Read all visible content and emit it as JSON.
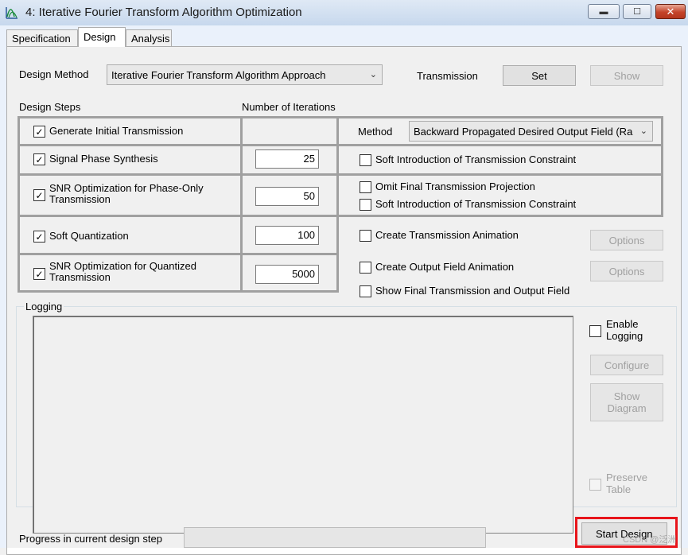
{
  "window": {
    "title": "4: Iterative Fourier Transform Algorithm Optimization",
    "icon": "app-icon",
    "controls": [
      "minimize",
      "maximize",
      "close"
    ]
  },
  "tabs": [
    {
      "label": "Specification",
      "active": false
    },
    {
      "label": "Design",
      "active": true
    },
    {
      "label": "Analysis",
      "active": false
    }
  ],
  "design": {
    "method_label": "Design Method",
    "method_value": "Iterative Fourier Transform Algorithm Approach",
    "transmission_label": "Transmission",
    "set_button": "Set",
    "show_button": "Show"
  },
  "steps_header": "Design Steps",
  "iterations_header": "Number of Iterations",
  "steps": [
    {
      "label": "Generate Initial Transmission",
      "checked": true,
      "iterations": ""
    },
    {
      "label": "Signal Phase Synthesis",
      "checked": true,
      "iterations": "25"
    },
    {
      "label": "SNR Optimization for Phase-Only Transmission",
      "checked": true,
      "iterations": "50"
    },
    {
      "label": "Soft Quantization",
      "checked": true,
      "iterations": "100"
    },
    {
      "label": "SNR Optimization for Quantized Transmission",
      "checked": true,
      "iterations": "5000"
    }
  ],
  "options": {
    "method_label": "Method",
    "method_value": "Backward Propagated Desired Output Field (Ra",
    "soft_intro_1": "Soft Introduction of Transmission Constraint",
    "omit_final": "Omit Final Transmission Projection",
    "soft_intro_2": "Soft Introduction of Transmission Constraint",
    "create_transmission_anim": "Create Transmission Animation",
    "create_output_anim": "Create Output Field Animation",
    "show_final": "Show Final Transmission and Output Field",
    "options_button": "Options"
  },
  "logging": {
    "label": "Logging",
    "enable_logging": "Enable Logging",
    "configure_button": "Configure",
    "show_diagram_button": "Show Diagram",
    "preserve_table": "Preserve Table"
  },
  "footer": {
    "progress_label": "Progress in current design step",
    "progress": 0,
    "start_button": "Start Design",
    "watermark": "CSDN @泛洲"
  }
}
